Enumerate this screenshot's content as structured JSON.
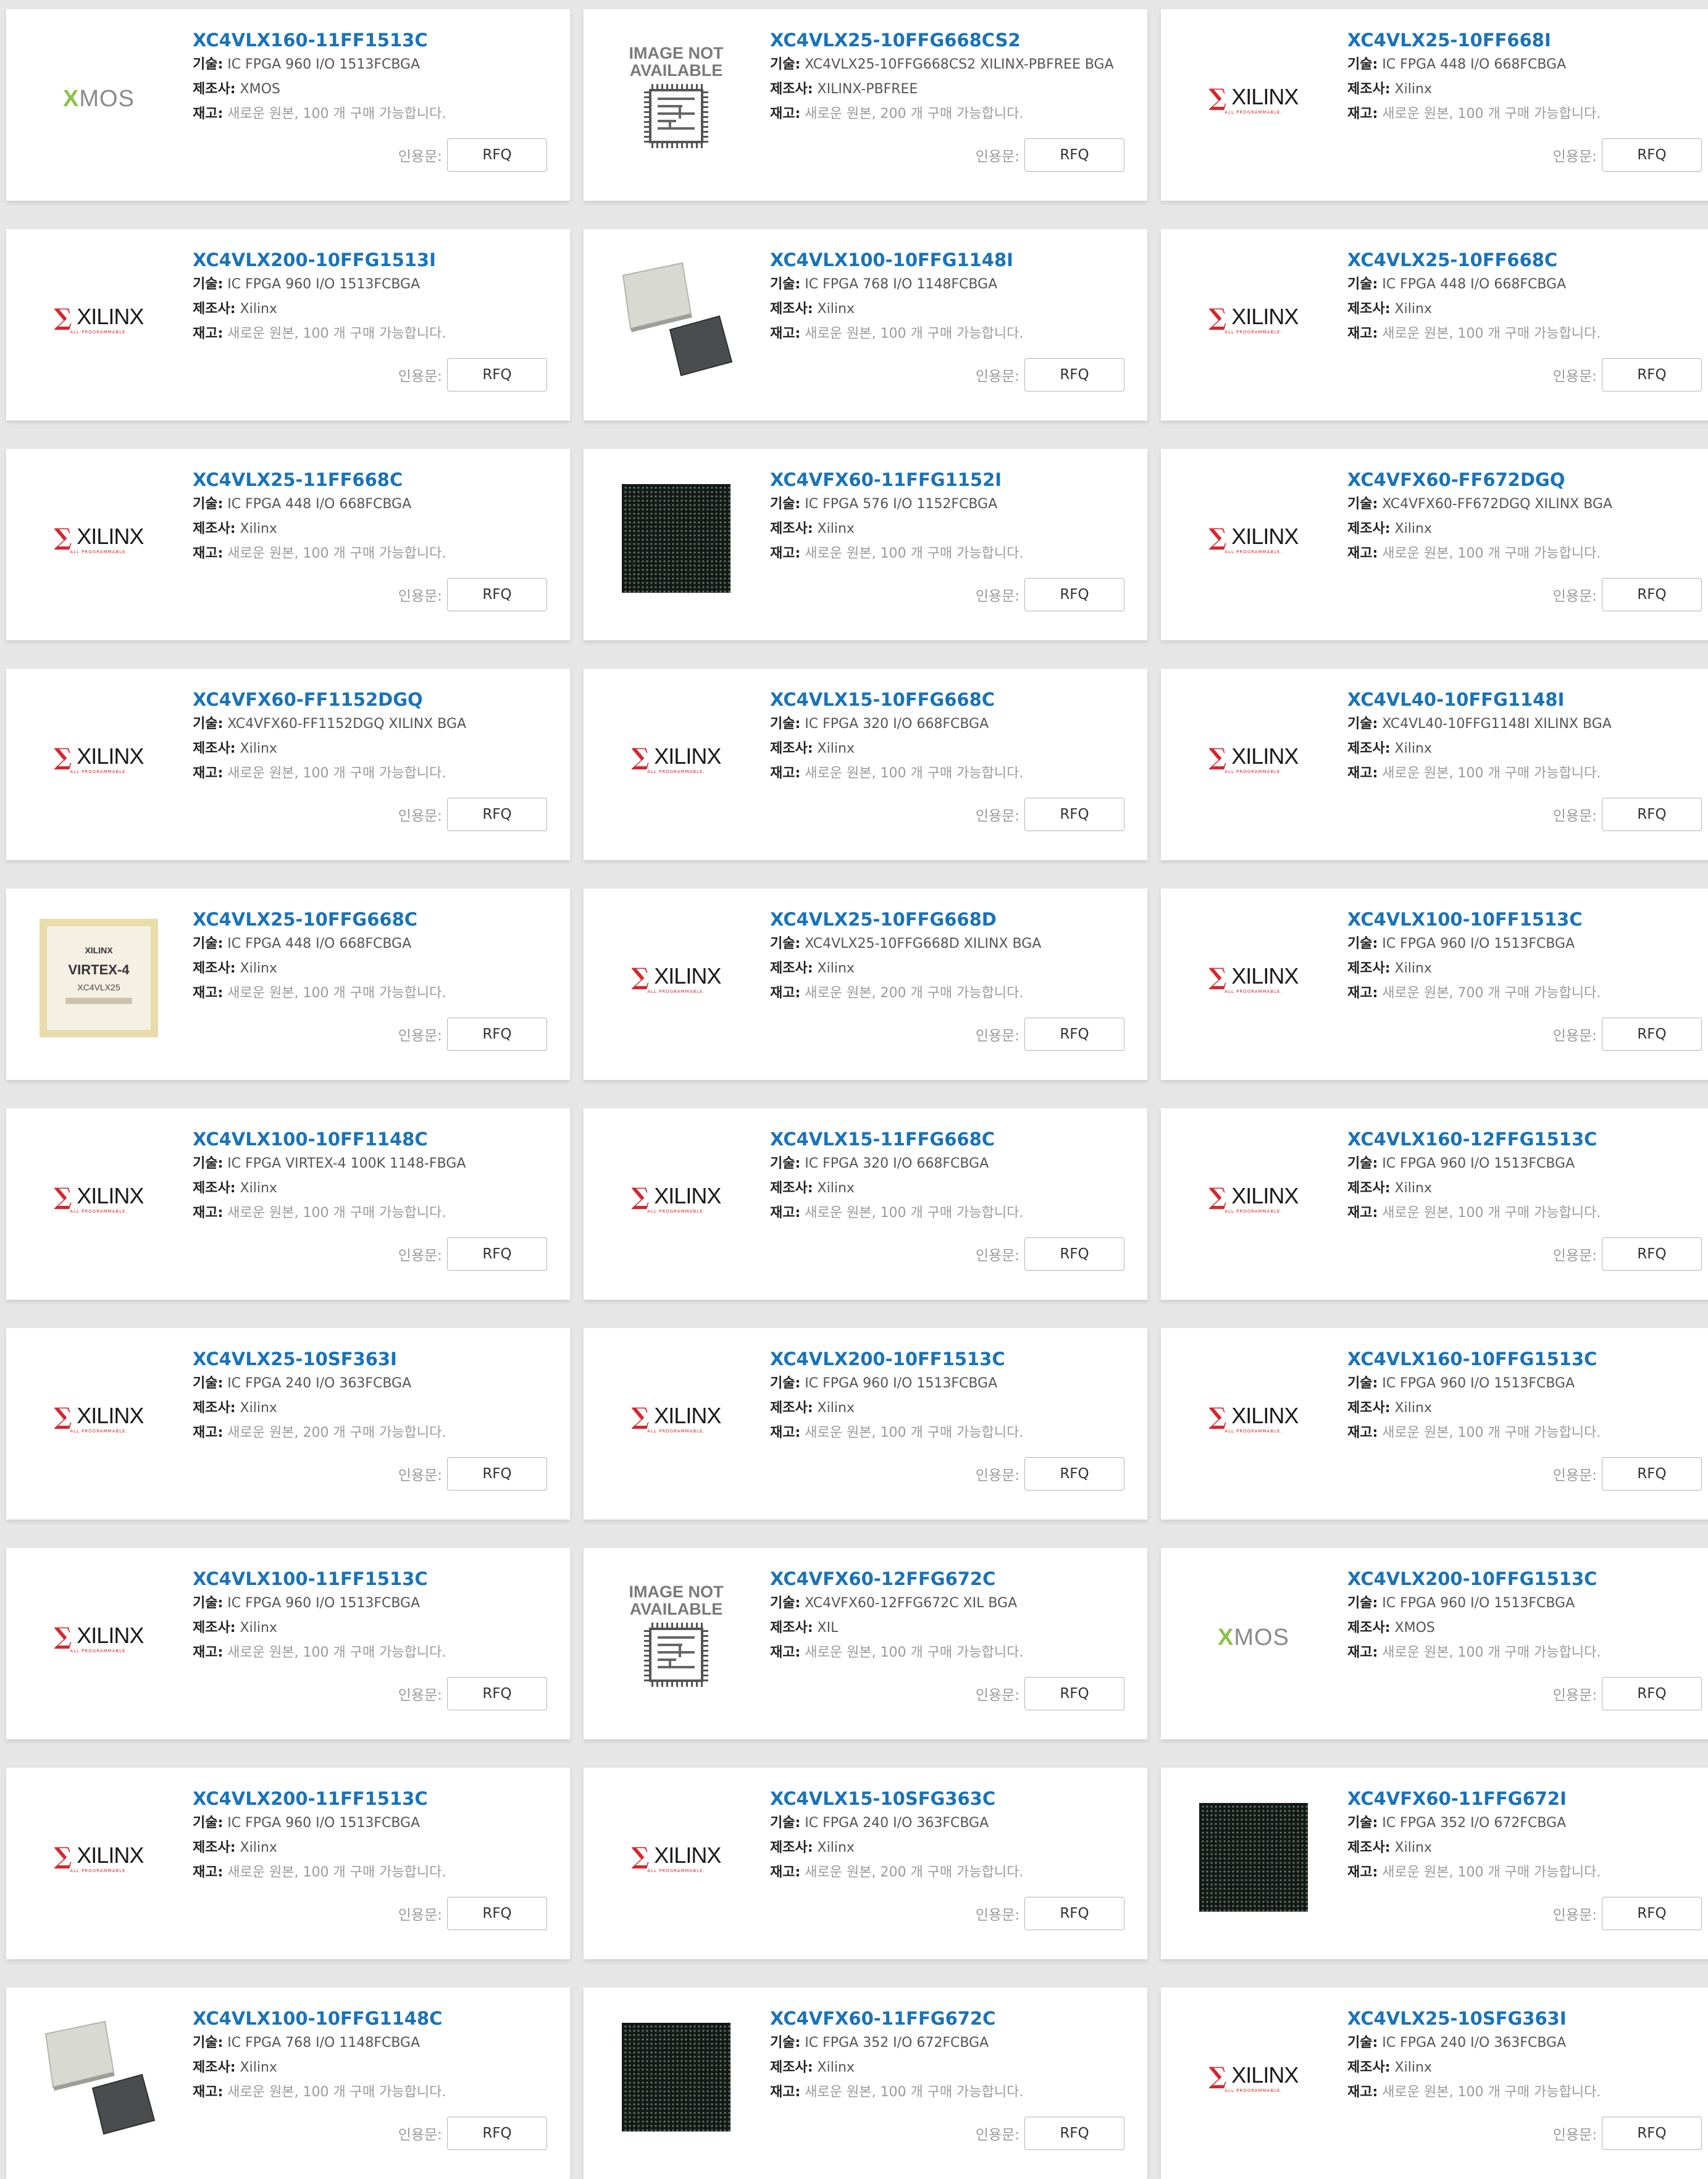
{
  "labels": {
    "desc": "기술:",
    "maker": "제조사:",
    "stock": "재고:",
    "quote": "인용문:",
    "rfq": "RFQ"
  },
  "image_placeholder": [
    "IMAGE NOT",
    "AVAILABLE"
  ],
  "logos": {
    "xilinx": "XILINX",
    "xilinx_sub": "ALL PROGRAMMABLE.",
    "xmos_x": "X",
    "xmos_rest": "MOS"
  },
  "chip_marking": {
    "brand": "XILINX",
    "family": "VIRTEX-4",
    "part": "XC4VLX25"
  },
  "products": [
    {
      "part": "XC4VLX160-11FF1513C",
      "desc": "IC FPGA 960 I/O 1513FCBGA",
      "maker": "XMOS",
      "stock": "새로운 원본, 100 개 구매 가능합니다.",
      "image": "xmos-logo"
    },
    {
      "part": "XC4VLX25-10FFG668CS2",
      "desc": "XC4VLX25-10FFG668CS2 XILINX-PBFREE BGA",
      "maker": "XILINX-PBFREE",
      "stock": "새로운 원본, 200 개 구매 가능합니다.",
      "image": "not-available"
    },
    {
      "part": "XC4VLX25-10FF668I",
      "desc": "IC FPGA 448 I/O 668FCBGA",
      "maker": "Xilinx",
      "stock": "새로운 원본, 100 개 구매 가능합니다.",
      "image": "xilinx-logo"
    },
    {
      "part": "XC4VLX200-10FFG1513I",
      "desc": "IC FPGA 960 I/O 1513FCBGA",
      "maker": "Xilinx",
      "stock": "새로운 원본, 100 개 구매 가능합니다.",
      "image": "xilinx-logo"
    },
    {
      "part": "XC4VLX100-10FFG1148I",
      "desc": "IC FPGA 768 I/O 1148FCBGA",
      "maker": "Xilinx",
      "stock": "새로운 원본, 100 개 구매 가능합니다.",
      "image": "chip-pair"
    },
    {
      "part": "XC4VLX25-10FF668C",
      "desc": "IC FPGA 448 I/O 668FCBGA",
      "maker": "Xilinx",
      "stock": "새로운 원본, 100 개 구매 가능합니다.",
      "image": "xilinx-logo"
    },
    {
      "part": "XC4VLX25-11FF668C",
      "desc": "IC FPGA 448 I/O 668FCBGA",
      "maker": "Xilinx",
      "stock": "새로운 원본, 100 개 구매 가능합니다.",
      "image": "xilinx-logo"
    },
    {
      "part": "XC4VFX60-11FFG1152I",
      "desc": "IC FPGA 576 I/O 1152FCBGA",
      "maker": "Xilinx",
      "stock": "새로운 원본, 100 개 구매 가능합니다.",
      "image": "bga-dark"
    },
    {
      "part": "XC4VFX60-FF672DGQ",
      "desc": "XC4VFX60-FF672DGQ XILINX BGA",
      "maker": "Xilinx",
      "stock": "새로운 원본, 100 개 구매 가능합니다.",
      "image": "xilinx-logo"
    },
    {
      "part": "XC4VFX60-FF1152DGQ",
      "desc": "XC4VFX60-FF1152DGQ XILINX BGA",
      "maker": "Xilinx",
      "stock": "새로운 원본, 100 개 구매 가능합니다.",
      "image": "xilinx-logo"
    },
    {
      "part": "XC4VLX15-10FFG668C",
      "desc": "IC FPGA 320 I/O 668FCBGA",
      "maker": "Xilinx",
      "stock": "새로운 원본, 100 개 구매 가능합니다.",
      "image": "xilinx-logo"
    },
    {
      "part": "XC4VL40-10FFG1148I",
      "desc": "XC4VL40-10FFG1148I XILINX BGA",
      "maker": "Xilinx",
      "stock": "새로운 원본, 100 개 구매 가능합니다.",
      "image": "xilinx-logo"
    },
    {
      "part": "XC4VLX25-10FFG668C",
      "desc": "IC FPGA 448 I/O 668FCBGA",
      "maker": "Xilinx",
      "stock": "새로운 원본, 100 개 구매 가능합니다.",
      "image": "virtex-chip"
    },
    {
      "part": "XC4VLX25-10FFG668D",
      "desc": "XC4VLX25-10FFG668D XILINX BGA",
      "maker": "Xilinx",
      "stock": "새로운 원본, 200 개 구매 가능합니다.",
      "image": "xilinx-logo"
    },
    {
      "part": "XC4VLX100-10FF1513C",
      "desc": "IC FPGA 960 I/O 1513FCBGA",
      "maker": "Xilinx",
      "stock": "새로운 원본, 700 개 구매 가능합니다.",
      "image": "xilinx-logo"
    },
    {
      "part": "XC4VLX100-10FF1148C",
      "desc": "IC FPGA VIRTEX-4 100K 1148-FBGA",
      "maker": "Xilinx",
      "stock": "새로운 원본, 100 개 구매 가능합니다.",
      "image": "xilinx-logo"
    },
    {
      "part": "XC4VLX15-11FFG668C",
      "desc": "IC FPGA 320 I/O 668FCBGA",
      "maker": "Xilinx",
      "stock": "새로운 원본, 100 개 구매 가능합니다.",
      "image": "xilinx-logo"
    },
    {
      "part": "XC4VLX160-12FFG1513C",
      "desc": "IC FPGA 960 I/O 1513FCBGA",
      "maker": "Xilinx",
      "stock": "새로운 원본, 100 개 구매 가능합니다.",
      "image": "xilinx-logo"
    },
    {
      "part": "XC4VLX25-10SF363I",
      "desc": "IC FPGA 240 I/O 363FCBGA",
      "maker": "Xilinx",
      "stock": "새로운 원본, 200 개 구매 가능합니다.",
      "image": "xilinx-logo"
    },
    {
      "part": "XC4VLX200-10FF1513C",
      "desc": "IC FPGA 960 I/O 1513FCBGA",
      "maker": "Xilinx",
      "stock": "새로운 원본, 100 개 구매 가능합니다.",
      "image": "xilinx-logo"
    },
    {
      "part": "XC4VLX160-10FFG1513C",
      "desc": "IC FPGA 960 I/O 1513FCBGA",
      "maker": "Xilinx",
      "stock": "새로운 원본, 100 개 구매 가능합니다.",
      "image": "xilinx-logo"
    },
    {
      "part": "XC4VLX100-11FF1513C",
      "desc": "IC FPGA 960 I/O 1513FCBGA",
      "maker": "Xilinx",
      "stock": "새로운 원본, 100 개 구매 가능합니다.",
      "image": "xilinx-logo"
    },
    {
      "part": "XC4VFX60-12FFG672C",
      "desc": "XC4VFX60-12FFG672C XIL BGA",
      "maker": "XIL",
      "stock": "새로운 원본, 100 개 구매 가능합니다.",
      "image": "not-available"
    },
    {
      "part": "XC4VLX200-10FFG1513C",
      "desc": "IC FPGA 960 I/O 1513FCBGA",
      "maker": "XMOS",
      "stock": "새로운 원본, 100 개 구매 가능합니다.",
      "image": "xmos-logo"
    },
    {
      "part": "XC4VLX200-11FF1513C",
      "desc": "IC FPGA 960 I/O 1513FCBGA",
      "maker": "Xilinx",
      "stock": "새로운 원본, 100 개 구매 가능합니다.",
      "image": "xilinx-logo"
    },
    {
      "part": "XC4VLX15-10SFG363C",
      "desc": "IC FPGA 240 I/O 363FCBGA",
      "maker": "Xilinx",
      "stock": "새로운 원본, 200 개 구매 가능합니다.",
      "image": "xilinx-logo"
    },
    {
      "part": "XC4VFX60-11FFG672I",
      "desc": "IC FPGA 352 I/O 672FCBGA",
      "maker": "Xilinx",
      "stock": "새로운 원본, 100 개 구매 가능합니다.",
      "image": "bga-dark"
    },
    {
      "part": "XC4VLX100-10FFG1148C",
      "desc": "IC FPGA 768 I/O 1148FCBGA",
      "maker": "Xilinx",
      "stock": "새로운 원본, 100 개 구매 가능합니다.",
      "image": "chip-pair"
    },
    {
      "part": "XC4VFX60-11FFG672C",
      "desc": "IC FPGA 352 I/O 672FCBGA",
      "maker": "Xilinx",
      "stock": "새로운 원본, 100 개 구매 가능합니다.",
      "image": "bga-dark"
    },
    {
      "part": "XC4VLX25-10SFG363I",
      "desc": "IC FPGA 240 I/O 363FCBGA",
      "maker": "Xilinx",
      "stock": "새로운 원본, 100 개 구매 가능합니다.",
      "image": "xilinx-logo"
    }
  ]
}
